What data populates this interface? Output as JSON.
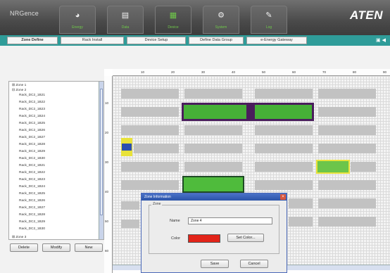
{
  "app": {
    "brand": "NRGence",
    "vendor_logo": "ATEN"
  },
  "nav_tabs": [
    {
      "label": "Energy",
      "icon": "gauge-icon"
    },
    {
      "label": "Data",
      "icon": "chart-icon"
    },
    {
      "label": "Device",
      "icon": "grid-icon"
    },
    {
      "label": "System",
      "icon": "gear-icon"
    },
    {
      "label": "Log",
      "icon": "pencil-icon"
    }
  ],
  "sub_tabs": [
    {
      "label": "Zone Define",
      "active": true
    },
    {
      "label": "Rack Install",
      "active": false
    },
    {
      "label": "Device Setup",
      "active": false
    },
    {
      "label": "Define Data Group",
      "active": false
    },
    {
      "label": "e-Energy Gateway",
      "active": false
    }
  ],
  "tree": {
    "zone1": "Zone 1",
    "zone2": "Zone 2",
    "racks": [
      "Rack_DC2_1B21",
      "Rack_DC2_1B22",
      "Rack_DC2_1B23",
      "Rack_DC2_1B24",
      "Rack_DC2_1B25",
      "Rack_DC2_1B26",
      "Rack_DC2_1B27",
      "Rack_DC2_1B28",
      "Rack_DC2_1B29",
      "Rack_DC2_1B30",
      "Rack_DC2_1B21",
      "Rack_DC2_1B22",
      "Rack_DC2_1B23",
      "Rack_DC2_1B24",
      "Rack_DC2_1B25",
      "Rack_DC2_1B26",
      "Rack_DC2_1B27",
      "Rack_DC2_1B28",
      "Rack_DC2_1B29",
      "Rack_DC2_1B30"
    ],
    "last": "Zone 3"
  },
  "buttons": {
    "delete": "Delete",
    "modify": "Modify",
    "new": "New"
  },
  "ruler": {
    "top": [
      "10",
      "20",
      "30",
      "40",
      "50",
      "60",
      "70",
      "80",
      "90"
    ],
    "left": [
      "10",
      "20",
      "30",
      "40",
      "50",
      "60"
    ]
  },
  "dialog": {
    "title": "Zone Information",
    "group": "Zone",
    "name_label": "Name",
    "name_value": "Zone 4",
    "color_label": "Color",
    "color_value": "#e22419",
    "set_color": "Set Color...",
    "save": "Save",
    "cancel": "Cancel"
  },
  "colors": {
    "accent_teal": "#2f9c99",
    "tab_label_green": "#6fc94a",
    "rack_green": "#46b037",
    "zone_highlight": "#4a1d5c",
    "rack_yellow": "#e8e23a",
    "rack_blue": "#2b4fb0"
  }
}
